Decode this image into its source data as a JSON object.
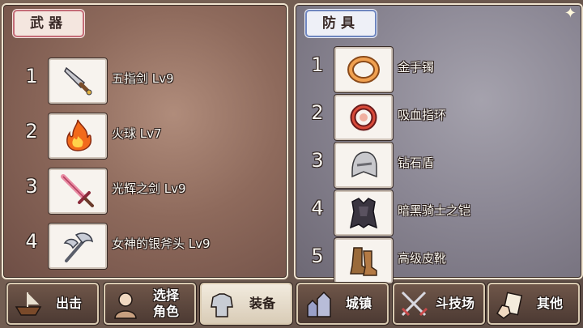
{
  "weapons": {
    "tab_label": "武器",
    "items": [
      {
        "num": "1",
        "name": "五指剑 Lv9",
        "icon": "dagger-icon"
      },
      {
        "num": "2",
        "name": "火球 Lv7",
        "icon": "fireball-icon"
      },
      {
        "num": "3",
        "name": "光辉之剑 Lv9",
        "icon": "sword-icon"
      },
      {
        "num": "4",
        "name": "女神的银斧头 Lv9",
        "icon": "axe-icon"
      }
    ]
  },
  "armor": {
    "tab_label": "防具",
    "items": [
      {
        "num": "1",
        "name": "金手镯",
        "icon": "bracelet-icon"
      },
      {
        "num": "2",
        "name": "吸血指环",
        "icon": "ring-icon"
      },
      {
        "num": "3",
        "name": "钻石盾",
        "icon": "helmet-icon"
      },
      {
        "num": "4",
        "name": "暗黑骑士之铠",
        "icon": "dark-armor-icon"
      },
      {
        "num": "5",
        "name": "高级皮靴",
        "icon": "boots-icon"
      }
    ]
  },
  "nav": {
    "attack": "出击",
    "select_line1": "选择",
    "select_line2": "角色",
    "equipment": "装备",
    "town": "城镇",
    "arena": "斗技场",
    "other": "其他"
  },
  "colors": {
    "weapons_tab_border": "#c46c78",
    "armor_tab_border": "#6f86bf"
  }
}
